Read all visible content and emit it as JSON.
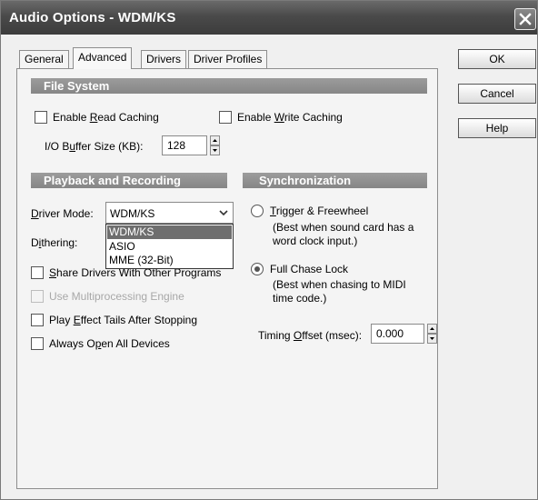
{
  "window": {
    "title": "Audio Options - WDM/KS",
    "close_icon": "close-icon"
  },
  "tabs": [
    {
      "label": "General",
      "active": false
    },
    {
      "label": "Advanced",
      "active": true
    },
    {
      "label": "Drivers",
      "active": false
    },
    {
      "label": "Driver Profiles",
      "active": false
    }
  ],
  "buttons": {
    "ok": "OK",
    "cancel": "Cancel",
    "help": "Help"
  },
  "file_system": {
    "header": "File System",
    "read_caching": {
      "pre": "Enable ",
      "accel": "R",
      "post": "ead Caching",
      "checked": false
    },
    "write_caching": {
      "pre": "Enable ",
      "accel": "W",
      "post": "rite Caching",
      "checked": false
    },
    "buffer_size": {
      "pre": "I/O B",
      "accel": "u",
      "post": "ffer Size (KB):",
      "value": "128"
    }
  },
  "playback": {
    "header": "Playback and Recording",
    "driver_mode": {
      "accel": "D",
      "post": "river Mode:",
      "value": "WDM/KS"
    },
    "dithering": {
      "pre": "D",
      "accel": "i",
      "post": "thering:"
    },
    "dropdown_options": [
      "WDM/KS",
      "ASIO",
      "MME (32-Bit)"
    ],
    "share_drivers": {
      "accel": "S",
      "post": "hare Drivers With Other Programs",
      "checked": false
    },
    "multiprocessing": {
      "label": "Use Multiprocessing Engine",
      "checked": false,
      "enabled": false
    },
    "effect_tails": {
      "pre": "Play ",
      "accel": "E",
      "post": "ffect Tails After Stopping",
      "checked": false
    },
    "open_devices": {
      "pre": "Always O",
      "accel": "p",
      "post": "en All Devices",
      "checked": false
    }
  },
  "sync": {
    "header": "Synchronization",
    "trigger": {
      "accel": "T",
      "post": "rigger & Freewheel",
      "selected": false,
      "desc1": "(Best when sound card has a",
      "desc2": "word clock input.)"
    },
    "chase": {
      "label": "Full Chase Lock",
      "selected": true,
      "desc1": "(Best when chasing to MIDI",
      "desc2": "time code.)"
    },
    "timing_offset": {
      "pre": "Timing ",
      "accel": "O",
      "post": "ffset (msec):",
      "value": "0.000"
    }
  },
  "colors": {
    "title_bar": "#4a4a4a",
    "group_header": "#8e8e8e",
    "dropdown_selected": "#6e6e6e"
  }
}
